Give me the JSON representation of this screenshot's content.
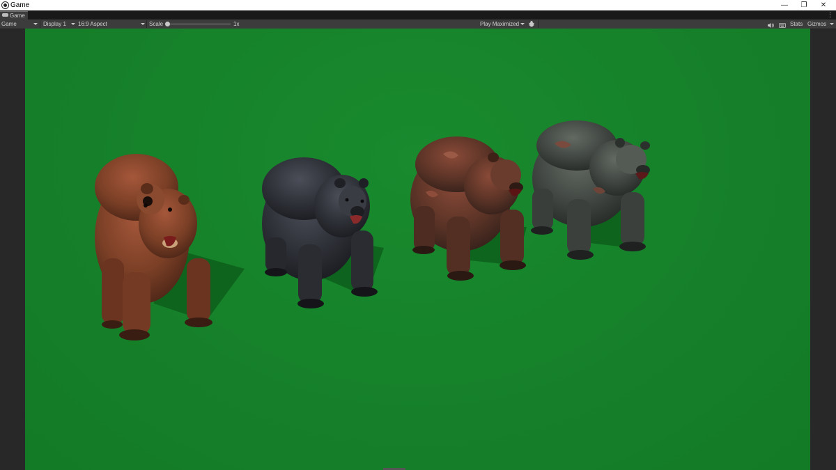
{
  "window": {
    "title": "Game",
    "minimize": "—",
    "restore": "❐",
    "close": "✕"
  },
  "tab": {
    "label": "Game",
    "icon": "gamepad-icon",
    "menu": "⋮"
  },
  "toolbar": {
    "view_mode": "Game",
    "display": "Display 1",
    "aspect": "16:9 Aspect",
    "scale_label": "Scale",
    "scale_value": "1x",
    "scale_fraction": 0,
    "play_mode": "Play Maximized",
    "bug_icon": "bug-icon",
    "audio_icon": "speaker-icon",
    "keyboard_icon": "keyboard-icon",
    "stats": "Stats",
    "gizmos": "Gizmos"
  },
  "scene": {
    "background_color": "#158029",
    "bears": [
      {
        "name": "brown-bear",
        "fur": "#7a3f26"
      },
      {
        "name": "black-bear",
        "fur": "#2d2f36"
      },
      {
        "name": "zombie-bear-red",
        "fur": "#5a3326"
      },
      {
        "name": "zombie-bear-green",
        "fur": "#3f4440"
      }
    ]
  }
}
